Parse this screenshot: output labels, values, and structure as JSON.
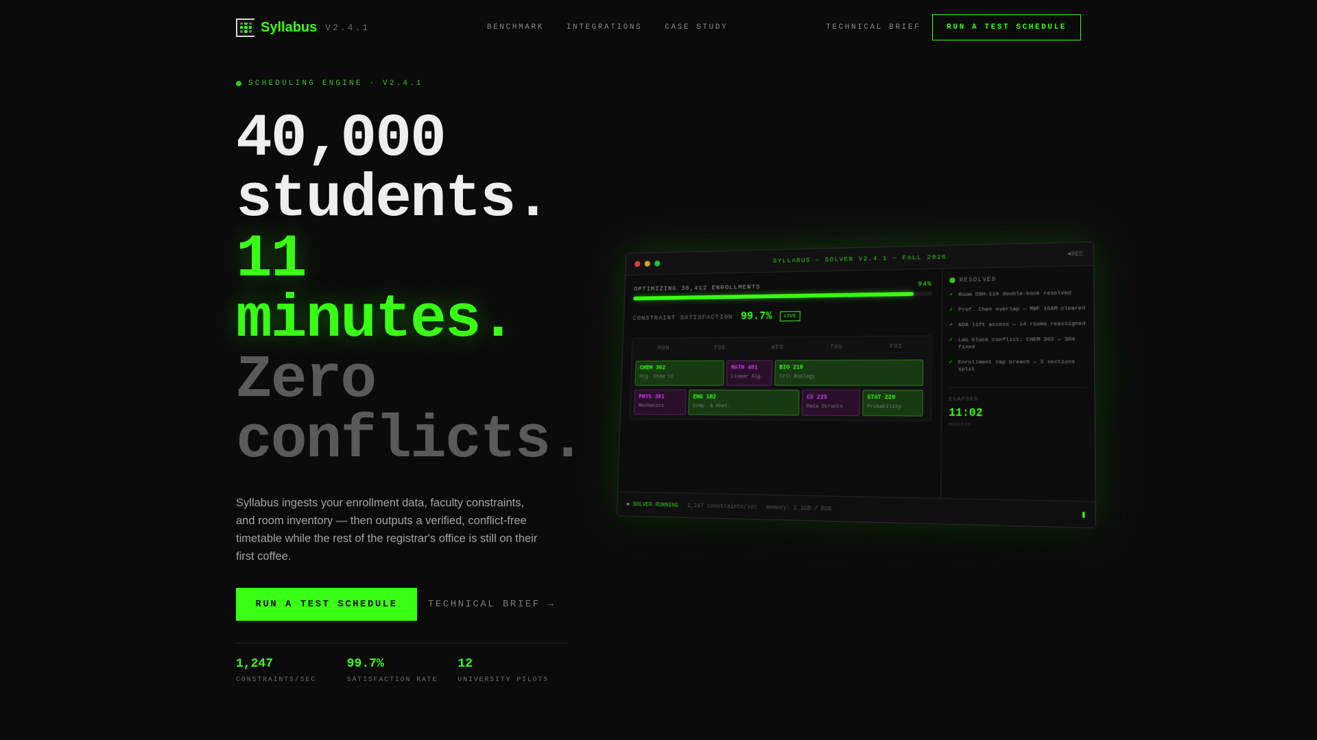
{
  "nav": {
    "brand": "Syllabus",
    "version": "V2.4.1",
    "links": [
      "BENCHMARK",
      "INTEGRATIONS",
      "CASE STUDY"
    ],
    "brief_link": "TECHNICAL BRIEF",
    "cta": "RUN A TEST SCHEDULE"
  },
  "hero": {
    "eyebrow": "SCHEDULING ENGINE · V2.4.1",
    "headline_line1": "40,000 students.",
    "headline_line2": "11 minutes.",
    "headline_line3": "Zero conflicts.",
    "description": "Syllabus ingests your enrollment data, faculty constraints, and room inventory — then outputs a verified, conflict-free timetable while the rest of the registrar's office is still on their first coffee.",
    "primary_cta": "RUN A TEST SCHEDULE",
    "secondary_cta": "TECHNICAL BRIEF →"
  },
  "stats": [
    {
      "value": "1,247",
      "label": "CONSTRAINTS/SEC"
    },
    {
      "value": "99.7%",
      "label": "SATISFACTION RATE"
    },
    {
      "value": "12",
      "label": "UNIVERSITY PILOTS"
    }
  ],
  "dashboard": {
    "title": "SYLLABUS — SOLVER V2.4.1 — FALL 2026",
    "rec": "●REC",
    "optimizing_label": "OPTIMIZING 38,412 ENROLLMENTS",
    "progress_pct_label": "94%",
    "progress_fraction": 0.94,
    "satisfaction_label": "CONSTRAINT SATISFACTION",
    "satisfaction_value": "99.7%",
    "live_badge": "LIVE",
    "days": [
      "MON",
      "TUE",
      "WED",
      "THU",
      "FRI"
    ],
    "courses_row1": [
      {
        "code": "CHEM 302",
        "name": "Org. Chem II",
        "color": "green"
      },
      {
        "code": "MATH 401",
        "name": "Linear Alg.",
        "color": "purple"
      },
      {
        "code": "BIO 210",
        "name": "Cell Biology",
        "color": "green"
      }
    ],
    "courses_row2": [
      {
        "code": "PHYS 301",
        "name": "Mechanics",
        "color": "purple"
      },
      {
        "code": "ENG 102",
        "name": "Comp. & Rhet.",
        "color": "green"
      },
      {
        "code": "CS 225",
        "name": "Data Structs",
        "color": "purple"
      },
      {
        "code": "STAT 220",
        "name": "Probability",
        "color": "green"
      }
    ],
    "resolved_label": "RESOLVED",
    "resolved": [
      "Room DBH-110 double-book resolved",
      "Prof. Chen overlap — MWF 10AM cleared",
      "ADA lift access — 14 rooms reassigned",
      "Lab block conflict: CHEM 302 — 304 fixed",
      "Enrollment cap breach — 3 sections split"
    ],
    "elapsed_label": "ELAPSED",
    "elapsed_value": "11:02",
    "elapsed_unit": "minutes",
    "status_running": "● SOLVER RUNNING",
    "status_rate": "1,247 constraints/sec",
    "status_memory": "memory: 2.1GB / 8GB"
  },
  "colors": {
    "accent": "#39ff14",
    "background": "#0b0b0b",
    "purple": "#d23cf0"
  }
}
